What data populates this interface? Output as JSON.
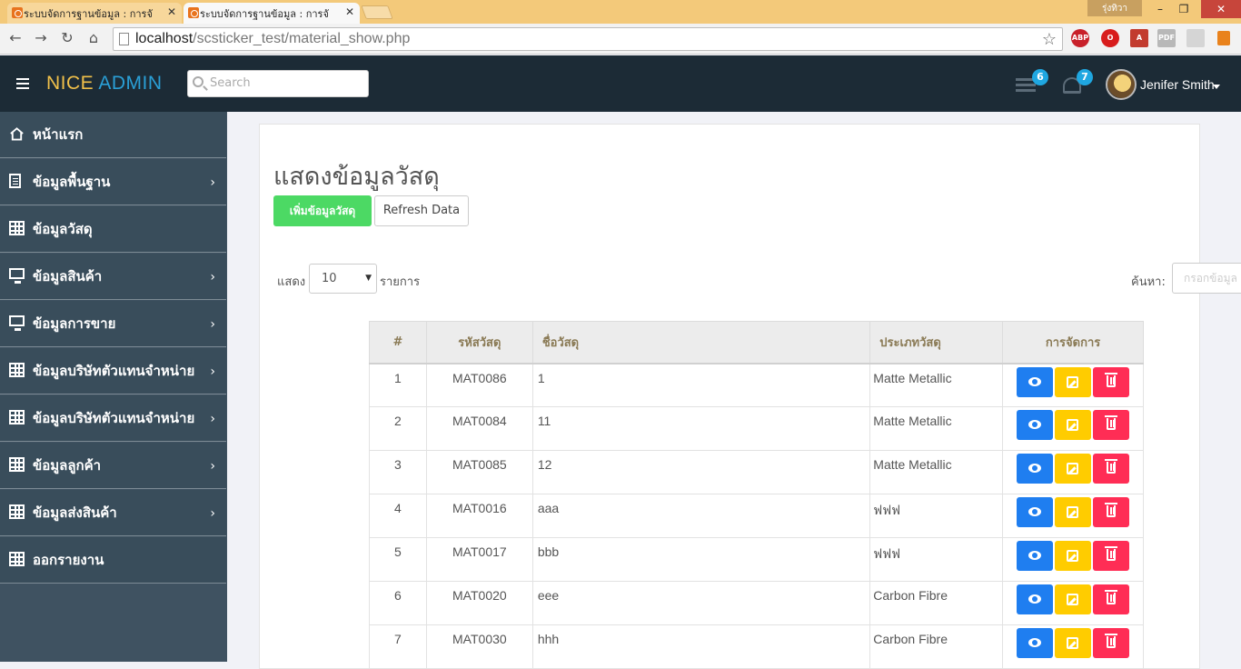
{
  "browser": {
    "tabs": [
      {
        "title": "ระบบจัดการฐานข้อมูล : การจั"
      },
      {
        "title": "ระบบจัดการฐานข้อมูล : การจั"
      }
    ],
    "user_badge": "รุ่งทิวา",
    "url_host": "localhost",
    "url_path": "/scsticker_test/material_show.php"
  },
  "header": {
    "logo_part1": "NICE",
    "logo_part2": "ADMIN",
    "search_placeholder": "Search",
    "tasks_badge": "6",
    "notifications_badge": "7",
    "user_name": "Jenifer Smith"
  },
  "sidebar": {
    "items": [
      {
        "label": "หน้าแรก",
        "icon": "home-icon",
        "chevron": ""
      },
      {
        "label": "ข้อมูลพื้นฐาน",
        "icon": "document-icon",
        "chevron": "›"
      },
      {
        "label": "ข้อมูลวัสดุ",
        "icon": "table-icon",
        "chevron": ""
      },
      {
        "label": "ข้อมูลสินค้า",
        "icon": "monitor-icon",
        "chevron": "›"
      },
      {
        "label": "ข้อมูลการขาย",
        "icon": "monitor-icon",
        "chevron": "›"
      },
      {
        "label": "ข้อมูลบริษัทตัวแทนจำหน่าย",
        "icon": "table-icon",
        "chevron": "›"
      },
      {
        "label": "ข้อมูลบริษัทตัวแทนจำหน่าย",
        "icon": "table-icon",
        "chevron": "›"
      },
      {
        "label": "ข้อมูลลูกค้า",
        "icon": "table-icon",
        "chevron": "›"
      },
      {
        "label": "ข้อมูลส่งสินค้า",
        "icon": "table-icon",
        "chevron": "›"
      },
      {
        "label": "ออกรายงาน",
        "icon": "table-icon",
        "chevron": ""
      }
    ]
  },
  "main": {
    "title": "แสดงข้อมูลวัสดุ",
    "add_button": "เพิ่มข้อมูลวัสดุ",
    "refresh_button": "Refresh Data",
    "length_prefix": "แสดง",
    "length_value": "10",
    "length_suffix": "รายการ",
    "search_label": "ค้นหา:",
    "search_placeholder": "กรอกข้อมูล",
    "table": {
      "headers": [
        "#",
        "รหัสวัสดุ",
        "ชื่อวัสดุ",
        "ประเภทวัสดุ",
        "การจัดการ"
      ],
      "rows": [
        [
          "1",
          "MAT0086",
          "1",
          "Matte Metallic"
        ],
        [
          "2",
          "MAT0084",
          "11",
          "Matte Metallic"
        ],
        [
          "3",
          "MAT0085",
          "12",
          "Matte Metallic"
        ],
        [
          "4",
          "MAT0016",
          "aaa",
          "ฟฟฟ"
        ],
        [
          "5",
          "MAT0017",
          "bbb",
          "ฟฟฟ"
        ],
        [
          "6",
          "MAT0020",
          "eee",
          "Carbon Fibre"
        ],
        [
          "7",
          "MAT0030",
          "hhh",
          "Carbon Fibre"
        ]
      ]
    }
  },
  "colors": {
    "header_bg": "#1c2b36",
    "sidebar_bg": "#394d5b",
    "add_green": "#4cd964",
    "view_blue": "#1f7ef0",
    "edit_yellow": "#ffcc00",
    "delete_red": "#ff2d55"
  }
}
